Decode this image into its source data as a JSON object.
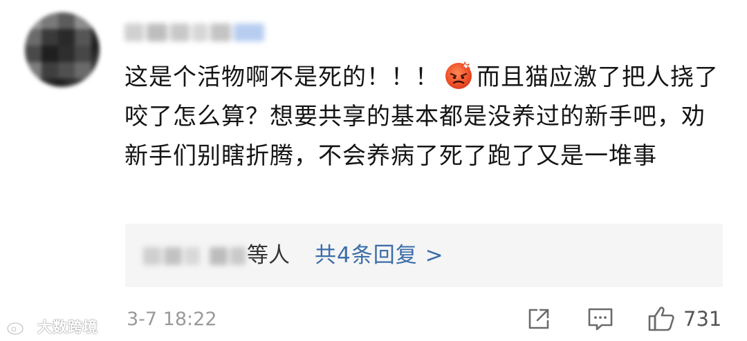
{
  "comment": {
    "text_before_emoji": "这是个活物啊不是死的！！！",
    "emoji": "angry-face",
    "text_after_emoji": "而且猫应激了把人挠了咬了怎么算？想要共享的基本都是没养过的新手吧，劝新手们别瞎折腾，不会养病了死了跑了又是一堆事"
  },
  "replies": {
    "others_label": "等人",
    "count_label": "共4条回复 >"
  },
  "footer": {
    "timestamp": "3-7 18:22",
    "like_count": "731"
  },
  "watermark": {
    "text": "大数跨境"
  },
  "colors": {
    "link_blue": "#3b6da8",
    "muted_gray": "#9a9a9a",
    "reply_bg": "#f5f5f5"
  }
}
